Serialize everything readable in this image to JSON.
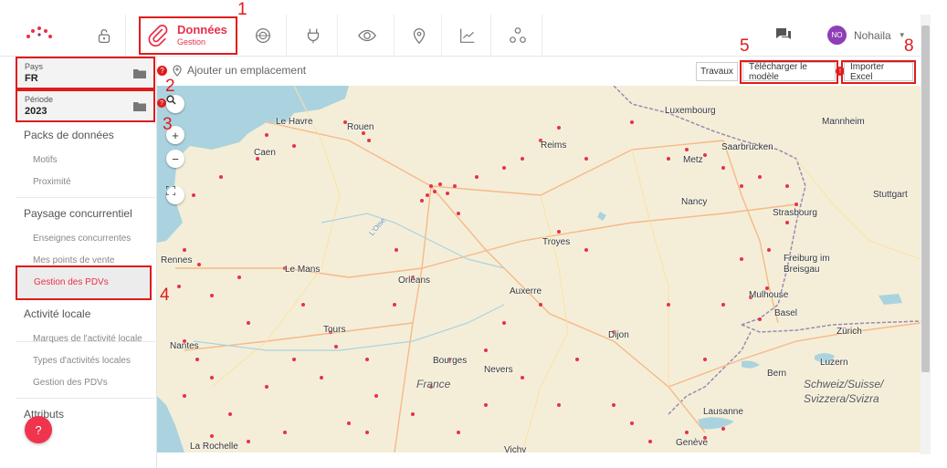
{
  "nav": {
    "tabs": [
      {
        "name": "Données",
        "sub": "Gestion",
        "icon": "paperclip-icon",
        "active": true
      },
      {
        "icon": "database-search-icon"
      },
      {
        "icon": "plug-icon"
      },
      {
        "icon": "eye-icon"
      },
      {
        "icon": "location-pin-icon"
      },
      {
        "icon": "chart-line-icon"
      },
      {
        "icon": "network-icon"
      }
    ],
    "user_initials": "NO",
    "user_name": "Nohaila",
    "accent": "#e8304a",
    "avatar_color": "#8e3fb5"
  },
  "annotations": [
    "1",
    "2",
    "3",
    "4",
    "5",
    "8"
  ],
  "sidebar": {
    "pays_label": "Pays",
    "pays_value": "FR",
    "periode_label": "Période",
    "periode_value": "2023",
    "sections": [
      {
        "title": "Packs de données",
        "items": [
          "Motifs",
          "Proximité"
        ]
      },
      {
        "title": "Paysage concurrentiel",
        "items": [
          "Enseignes concurrentes",
          "Mes points de vente",
          "Gestion des PDVs"
        ]
      },
      {
        "title": "Activité locale",
        "items": [
          "Marques de l'activité locale",
          "Types d'activités locales",
          "Gestion des PDVs"
        ]
      },
      {
        "title": "Attributs",
        "items": []
      }
    ],
    "help_label": "?"
  },
  "toolbar": {
    "add_location": "Ajouter un emplacement",
    "travaux": "Travaux",
    "download_template": "Télécharger le modèle",
    "import_excel": "Importer Excel"
  },
  "map": {
    "zoom_in": "+",
    "zoom_out": "−",
    "cities": [
      "Le Havre",
      "Rouen",
      "Caen",
      "Reims",
      "Luxembourg",
      "Mannheim",
      "Saarbrücken",
      "Metz",
      "Stuttgart",
      "Nancy",
      "Strasbourg",
      "Troyes",
      "Rennes",
      "Le Mans",
      "Orléans",
      "Auxerre",
      "Freiburg im Breisgau",
      "Mulhouse",
      "Basel",
      "Zürich",
      "Tours",
      "Dijon",
      "Nantes",
      "Bourges",
      "Nevers",
      "Bern",
      "Luzern",
      "Lausanne",
      "Genève",
      "La Rochelle",
      "Vichy"
    ],
    "countries": [
      "France",
      "Schweiz/Suisse/",
      "Svizzera/Svizra"
    ],
    "river_label": "L'Oise"
  }
}
